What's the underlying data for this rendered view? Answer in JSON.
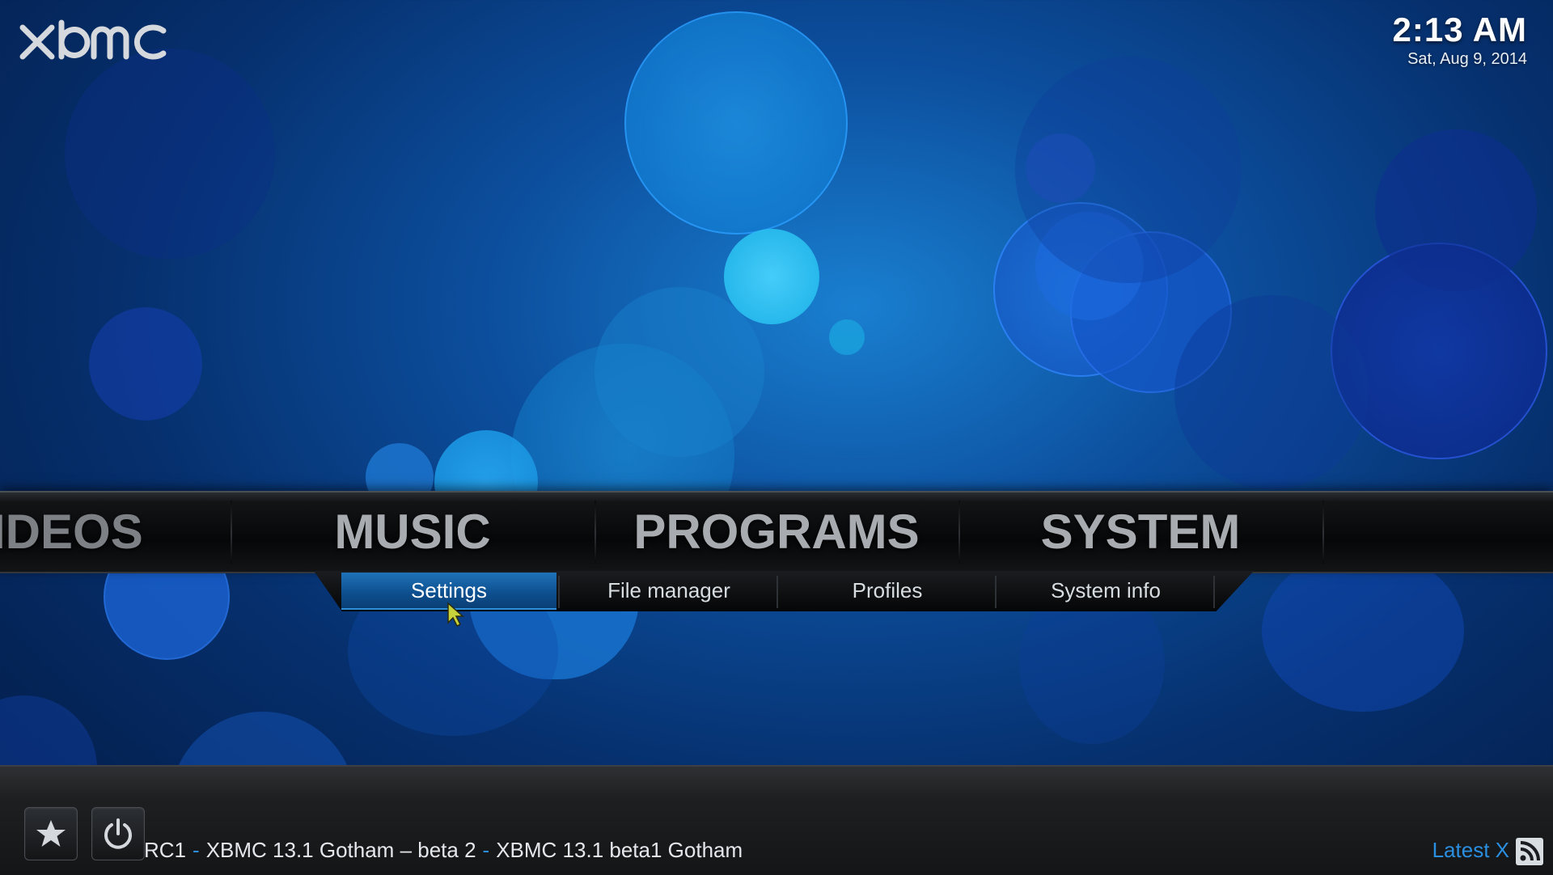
{
  "brand": {
    "logo_text": "xbmc"
  },
  "clock": {
    "time": "2:13 AM",
    "date": "Sat, Aug 9, 2014"
  },
  "main_menu": {
    "items": [
      {
        "label": "IDEOS"
      },
      {
        "label": "MUSIC"
      },
      {
        "label": "PROGRAMS"
      },
      {
        "label": "SYSTEM"
      }
    ],
    "selected": "SYSTEM"
  },
  "sub_menu": {
    "items": [
      {
        "label": "Settings",
        "active": true
      },
      {
        "label": "File manager",
        "active": false
      },
      {
        "label": "Profiles",
        "active": false
      },
      {
        "label": "System info",
        "active": false
      }
    ]
  },
  "bottom_bar": {
    "favourites_icon": "star-icon",
    "power_icon": "power-icon",
    "ticker": {
      "items": [
        "RC1",
        "XBMC 13.1 Gotham – beta 2",
        "XBMC 13.1 beta1 Gotham"
      ],
      "separator": "-"
    },
    "rss_label": "Latest X",
    "rss_icon": "rss-icon"
  },
  "colors": {
    "accent": "#2a8fe0",
    "active_tab": "#1f73b8",
    "menu_text": "#a8acb0"
  }
}
